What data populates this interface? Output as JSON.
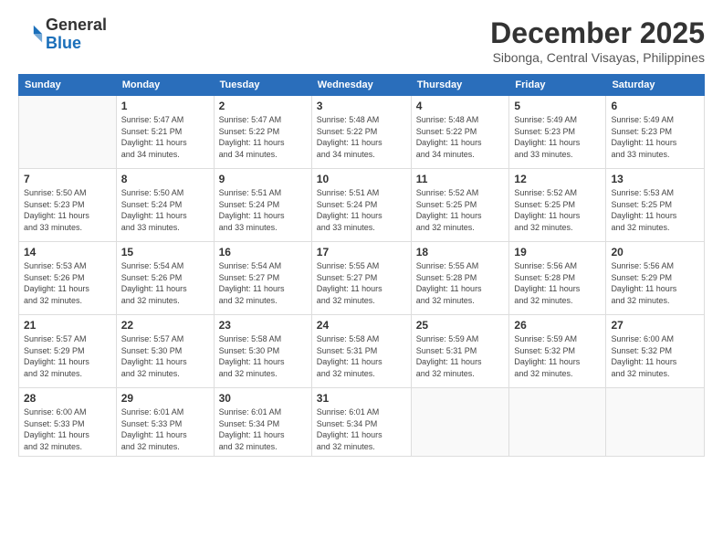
{
  "logo": {
    "line1": "General",
    "line2": "Blue"
  },
  "header": {
    "month_year": "December 2025",
    "location": "Sibonga, Central Visayas, Philippines"
  },
  "weekdays": [
    "Sunday",
    "Monday",
    "Tuesday",
    "Wednesday",
    "Thursday",
    "Friday",
    "Saturday"
  ],
  "weeks": [
    [
      {
        "day": "",
        "info": ""
      },
      {
        "day": "1",
        "info": "Sunrise: 5:47 AM\nSunset: 5:21 PM\nDaylight: 11 hours\nand 34 minutes."
      },
      {
        "day": "2",
        "info": "Sunrise: 5:47 AM\nSunset: 5:22 PM\nDaylight: 11 hours\nand 34 minutes."
      },
      {
        "day": "3",
        "info": "Sunrise: 5:48 AM\nSunset: 5:22 PM\nDaylight: 11 hours\nand 34 minutes."
      },
      {
        "day": "4",
        "info": "Sunrise: 5:48 AM\nSunset: 5:22 PM\nDaylight: 11 hours\nand 34 minutes."
      },
      {
        "day": "5",
        "info": "Sunrise: 5:49 AM\nSunset: 5:23 PM\nDaylight: 11 hours\nand 33 minutes."
      },
      {
        "day": "6",
        "info": "Sunrise: 5:49 AM\nSunset: 5:23 PM\nDaylight: 11 hours\nand 33 minutes."
      }
    ],
    [
      {
        "day": "7",
        "info": "Sunrise: 5:50 AM\nSunset: 5:23 PM\nDaylight: 11 hours\nand 33 minutes."
      },
      {
        "day": "8",
        "info": "Sunrise: 5:50 AM\nSunset: 5:24 PM\nDaylight: 11 hours\nand 33 minutes."
      },
      {
        "day": "9",
        "info": "Sunrise: 5:51 AM\nSunset: 5:24 PM\nDaylight: 11 hours\nand 33 minutes."
      },
      {
        "day": "10",
        "info": "Sunrise: 5:51 AM\nSunset: 5:24 PM\nDaylight: 11 hours\nand 33 minutes."
      },
      {
        "day": "11",
        "info": "Sunrise: 5:52 AM\nSunset: 5:25 PM\nDaylight: 11 hours\nand 32 minutes."
      },
      {
        "day": "12",
        "info": "Sunrise: 5:52 AM\nSunset: 5:25 PM\nDaylight: 11 hours\nand 32 minutes."
      },
      {
        "day": "13",
        "info": "Sunrise: 5:53 AM\nSunset: 5:25 PM\nDaylight: 11 hours\nand 32 minutes."
      }
    ],
    [
      {
        "day": "14",
        "info": "Sunrise: 5:53 AM\nSunset: 5:26 PM\nDaylight: 11 hours\nand 32 minutes."
      },
      {
        "day": "15",
        "info": "Sunrise: 5:54 AM\nSunset: 5:26 PM\nDaylight: 11 hours\nand 32 minutes."
      },
      {
        "day": "16",
        "info": "Sunrise: 5:54 AM\nSunset: 5:27 PM\nDaylight: 11 hours\nand 32 minutes."
      },
      {
        "day": "17",
        "info": "Sunrise: 5:55 AM\nSunset: 5:27 PM\nDaylight: 11 hours\nand 32 minutes."
      },
      {
        "day": "18",
        "info": "Sunrise: 5:55 AM\nSunset: 5:28 PM\nDaylight: 11 hours\nand 32 minutes."
      },
      {
        "day": "19",
        "info": "Sunrise: 5:56 AM\nSunset: 5:28 PM\nDaylight: 11 hours\nand 32 minutes."
      },
      {
        "day": "20",
        "info": "Sunrise: 5:56 AM\nSunset: 5:29 PM\nDaylight: 11 hours\nand 32 minutes."
      }
    ],
    [
      {
        "day": "21",
        "info": "Sunrise: 5:57 AM\nSunset: 5:29 PM\nDaylight: 11 hours\nand 32 minutes."
      },
      {
        "day": "22",
        "info": "Sunrise: 5:57 AM\nSunset: 5:30 PM\nDaylight: 11 hours\nand 32 minutes."
      },
      {
        "day": "23",
        "info": "Sunrise: 5:58 AM\nSunset: 5:30 PM\nDaylight: 11 hours\nand 32 minutes."
      },
      {
        "day": "24",
        "info": "Sunrise: 5:58 AM\nSunset: 5:31 PM\nDaylight: 11 hours\nand 32 minutes."
      },
      {
        "day": "25",
        "info": "Sunrise: 5:59 AM\nSunset: 5:31 PM\nDaylight: 11 hours\nand 32 minutes."
      },
      {
        "day": "26",
        "info": "Sunrise: 5:59 AM\nSunset: 5:32 PM\nDaylight: 11 hours\nand 32 minutes."
      },
      {
        "day": "27",
        "info": "Sunrise: 6:00 AM\nSunset: 5:32 PM\nDaylight: 11 hours\nand 32 minutes."
      }
    ],
    [
      {
        "day": "28",
        "info": "Sunrise: 6:00 AM\nSunset: 5:33 PM\nDaylight: 11 hours\nand 32 minutes."
      },
      {
        "day": "29",
        "info": "Sunrise: 6:01 AM\nSunset: 5:33 PM\nDaylight: 11 hours\nand 32 minutes."
      },
      {
        "day": "30",
        "info": "Sunrise: 6:01 AM\nSunset: 5:34 PM\nDaylight: 11 hours\nand 32 minutes."
      },
      {
        "day": "31",
        "info": "Sunrise: 6:01 AM\nSunset: 5:34 PM\nDaylight: 11 hours\nand 32 minutes."
      },
      {
        "day": "",
        "info": ""
      },
      {
        "day": "",
        "info": ""
      },
      {
        "day": "",
        "info": ""
      }
    ]
  ]
}
